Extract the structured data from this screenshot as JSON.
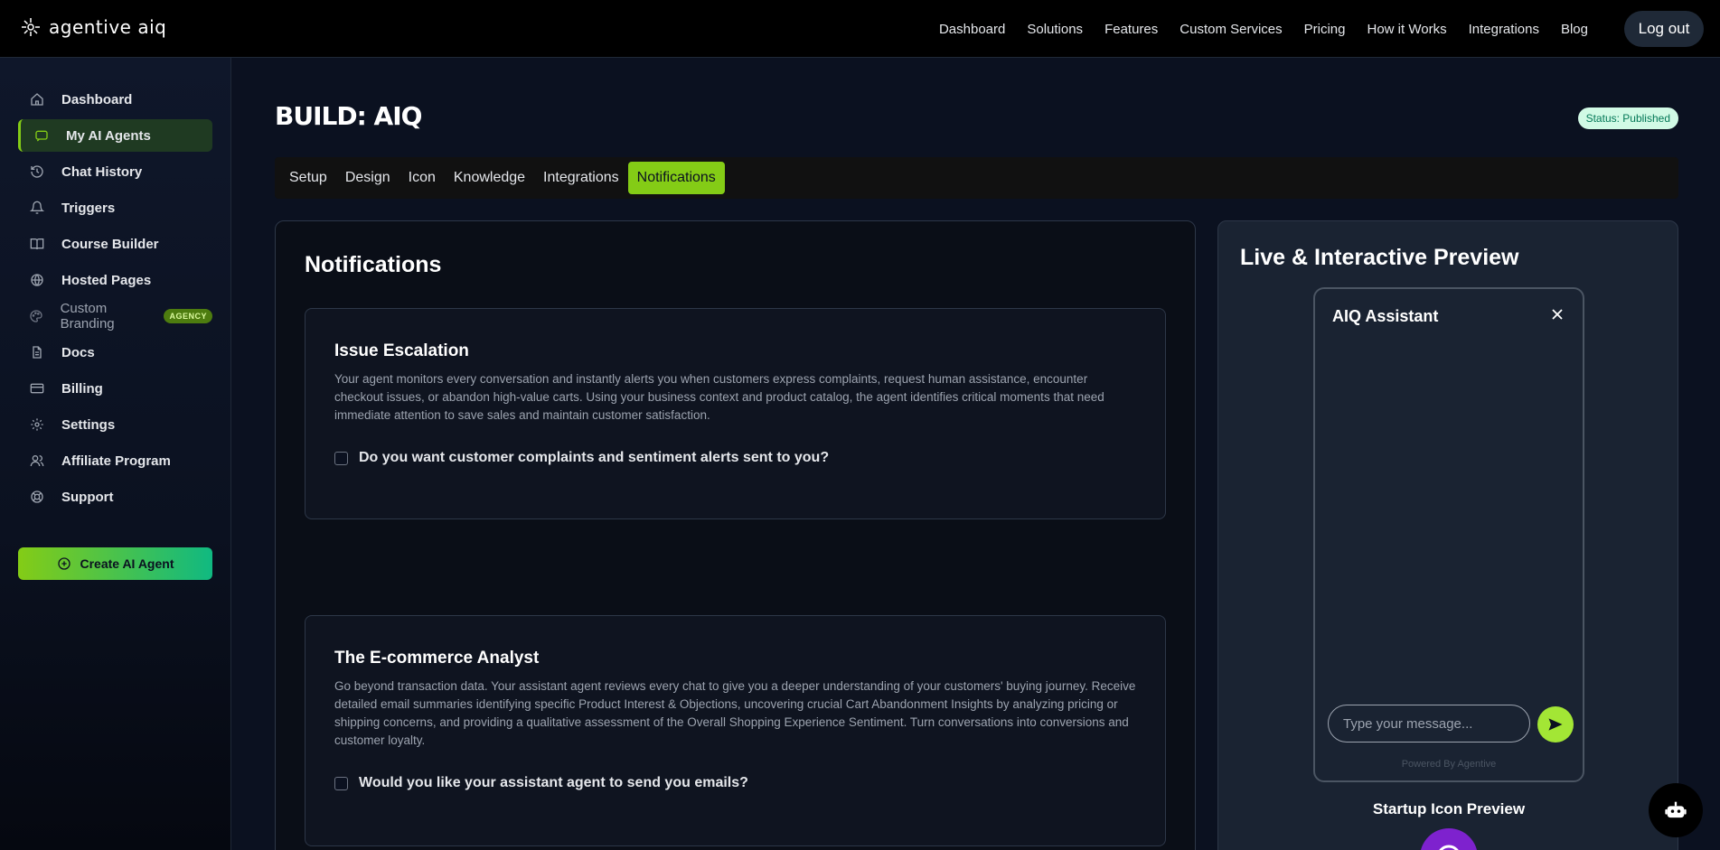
{
  "brand": {
    "name": "agentive aiq"
  },
  "nav": {
    "links": [
      "Dashboard",
      "Solutions",
      "Features",
      "Custom Services",
      "Pricing",
      "How it Works",
      "Integrations",
      "Blog"
    ],
    "logout": "Log out"
  },
  "sidebar": {
    "items": [
      {
        "label": "Dashboard",
        "icon": "home-icon"
      },
      {
        "label": "My AI Agents",
        "icon": "bot-message-icon",
        "active": true
      },
      {
        "label": "Chat History",
        "icon": "history-icon"
      },
      {
        "label": "Triggers",
        "icon": "bell-icon"
      },
      {
        "label": "Course Builder",
        "icon": "book-icon"
      },
      {
        "label": "Hosted Pages",
        "icon": "globe-icon"
      },
      {
        "label": "Custom Branding",
        "icon": "palette-icon",
        "badge": "AGENCY"
      },
      {
        "label": "Docs",
        "icon": "document-icon"
      },
      {
        "label": "Billing",
        "icon": "credit-card-icon"
      },
      {
        "label": "Settings",
        "icon": "gear-icon"
      },
      {
        "label": "Affiliate Program",
        "icon": "users-icon"
      },
      {
        "label": "Support",
        "icon": "lifebuoy-icon"
      }
    ],
    "create_button": "Create AI Agent"
  },
  "main": {
    "title": "BUILD: AIQ",
    "status": "Status: Published",
    "tabs": [
      "Setup",
      "Design",
      "Icon",
      "Knowledge",
      "Integrations",
      "Notifications"
    ],
    "active_tab": "Notifications",
    "panel_title": "Notifications",
    "cards": [
      {
        "title": "Issue Escalation",
        "description": "Your agent monitors every conversation and instantly alerts you when customers express complaints, request human assistance, encounter checkout issues, or abandon high-value carts. Using your business context and product catalog, the agent identifies critical moments that need immediate attention to save sales and maintain customer satisfaction.",
        "checkbox_label": "Do you want customer complaints and sentiment alerts sent to you?",
        "checked": false
      },
      {
        "title": "The E-commerce Analyst",
        "description": "Go beyond transaction data. Your assistant agent reviews every chat to give you a deeper understanding of your customers' buying journey. Receive detailed email summaries identifying specific Product Interest & Objections, uncovering crucial Cart Abandonment Insights by analyzing pricing or shipping concerns, and providing a qualitative assessment of the Overall Shopping Experience Sentiment. Turn conversations into conversions and customer loyalty.",
        "checkbox_label": "Would you like your assistant agent to send you emails?",
        "checked": false
      }
    ]
  },
  "preview": {
    "title": "Live & Interactive Preview",
    "chat_title": "AIQ Assistant",
    "input_placeholder": "Type your message...",
    "powered_by": "Powered By Agentive",
    "startup_label": "Startup Icon Preview"
  },
  "colors": {
    "accent": "#84cc16",
    "startup_icon": "#7e22ce",
    "status_bg": "#d1fae5",
    "status_text": "#047857"
  }
}
